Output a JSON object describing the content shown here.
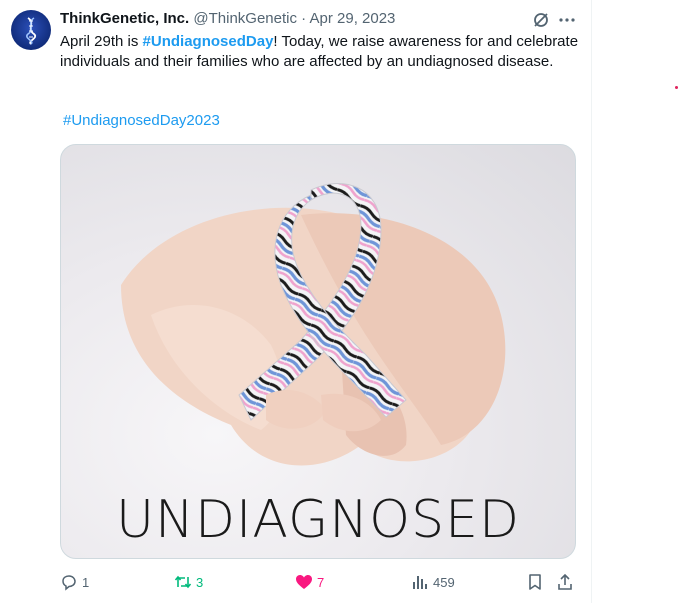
{
  "tweet": {
    "author_name": "ThinkGenetic, Inc.",
    "handle": "@ThinkGenetic",
    "separator": "·",
    "date": "Apr 29, 2023",
    "text_prefix": "April 29th is ",
    "hashtag_inline": "#UndiagnosedDay",
    "text_suffix": "! Today, we raise awareness for and celebrate individuals and their families who are affected by an undiagnosed disease.",
    "hashtag_tag": "#UndiagnosedDay2023",
    "media_caption": "UNDIAGNOSED"
  },
  "actions": {
    "reply_count": "1",
    "retweet_count": "3",
    "like_count": "7",
    "views_count": "459"
  },
  "icons": {
    "grok": "grok-icon",
    "more": "more-options-icon",
    "reply": "reply-icon",
    "retweet": "retweet-icon",
    "like": "heart-icon",
    "views": "views-icon",
    "bookmark": "bookmark-icon",
    "share": "share-icon"
  },
  "colors": {
    "link": "#1d9bf0",
    "retweet_green": "#00ba7c",
    "like_pink": "#f91880",
    "muted": "#536471",
    "ribbon_blue": "#6f95d8",
    "ribbon_pink": "#efa3cd"
  }
}
